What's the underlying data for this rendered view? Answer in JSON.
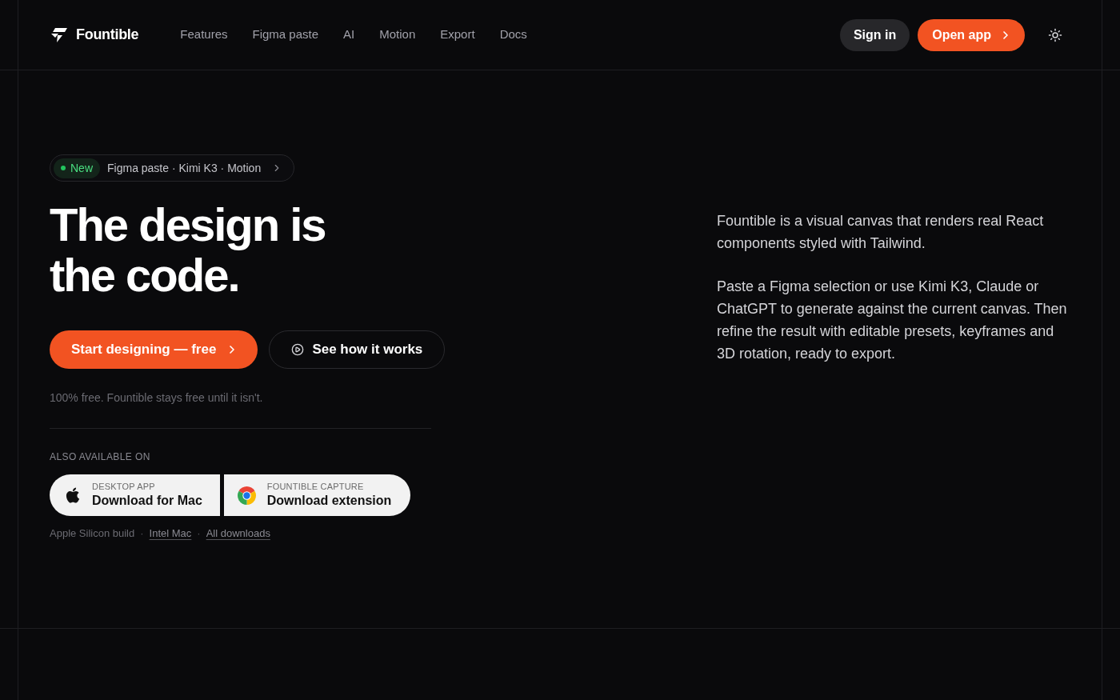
{
  "header": {
    "brand": "Fountible",
    "nav": [
      "Features",
      "Figma paste",
      "AI",
      "Motion",
      "Export",
      "Docs"
    ],
    "actions": [
      {
        "kind": "secondary",
        "label": "Sign in"
      },
      {
        "kind": "primary",
        "label": "Open app"
      }
    ]
  },
  "hero": {
    "announcement": {
      "tag": "New",
      "text": "Figma paste · Kimi K3 · Motion"
    },
    "title_lines": [
      "The design is",
      "the code."
    ],
    "cta": [
      {
        "kind": "primary",
        "label": "Start designing — free"
      },
      {
        "kind": "secondary",
        "label": "See how it works"
      }
    ],
    "note": "100% free. Fountible stays free until it isn't.",
    "platforms": {
      "heading": "ALSO AVAILABLE ON",
      "downloads": [
        {
          "kind": "mac",
          "caption": "DESKTOP APP",
          "label": "Download for Mac"
        },
        {
          "kind": "chrome",
          "caption": "FOUNTIBLE CAPTURE",
          "label": "Download extension"
        }
      ],
      "links": [
        {
          "kind": "note",
          "text": "Apple Silicon build"
        },
        {
          "kind": "separator",
          "text": "·"
        },
        {
          "kind": "link",
          "text": "Intel Mac"
        },
        {
          "kind": "separator",
          "text": "·"
        },
        {
          "kind": "link",
          "text": "All downloads"
        }
      ]
    }
  },
  "description": [
    "Fountible is a visual canvas that renders real React components styled with Tailwind.",
    "Paste a Figma selection or use Kimi K3, Claude or ChatGPT to generate against the current canvas. Then refine the result with editable presets, keyframes and 3D rotation, ready to export."
  ]
}
